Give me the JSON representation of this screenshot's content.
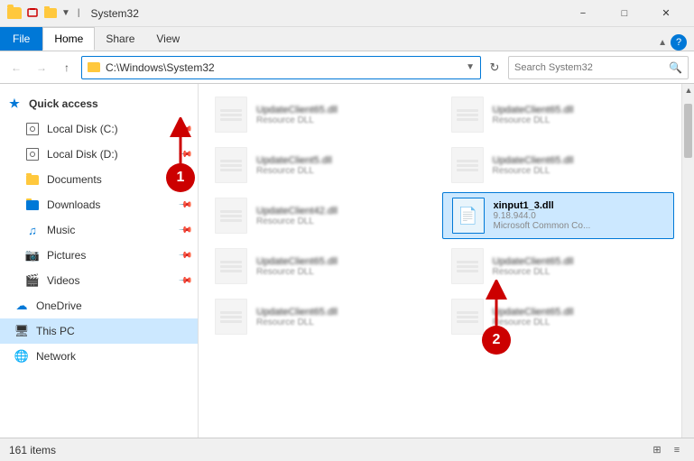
{
  "window": {
    "title": "System32",
    "title_bar_title": "System32"
  },
  "ribbon": {
    "tab_file": "File",
    "tab_home": "Home",
    "tab_share": "Share",
    "tab_view": "View",
    "active_tab": "Home"
  },
  "address_bar": {
    "path": "C:\\Windows\\System32",
    "search_placeholder": "Search System32"
  },
  "sidebar": {
    "items": [
      {
        "id": "quick-access",
        "label": "Quick access",
        "type": "section",
        "icon": "star"
      },
      {
        "id": "local-disk-c",
        "label": "Local Disk (C:)",
        "type": "disk",
        "icon": "disk",
        "pinned": true
      },
      {
        "id": "local-disk-d",
        "label": "Local Disk (D:)",
        "type": "disk",
        "icon": "disk",
        "pinned": true
      },
      {
        "id": "documents",
        "label": "Documents",
        "type": "folder",
        "icon": "folder",
        "pinned": true
      },
      {
        "id": "downloads",
        "label": "Downloads",
        "type": "folder",
        "icon": "folder",
        "pinned": true
      },
      {
        "id": "music",
        "label": "Music",
        "type": "folder",
        "icon": "music",
        "pinned": true
      },
      {
        "id": "pictures",
        "label": "Pictures",
        "type": "folder",
        "icon": "image",
        "pinned": true
      },
      {
        "id": "videos",
        "label": "Videos",
        "type": "folder",
        "icon": "video",
        "pinned": true
      },
      {
        "id": "onedrive",
        "label": "OneDrive",
        "type": "cloud",
        "icon": "cloud"
      },
      {
        "id": "this-pc",
        "label": "This PC",
        "type": "pc",
        "icon": "pc",
        "active": true
      },
      {
        "id": "network",
        "label": "Network",
        "type": "network",
        "icon": "network"
      }
    ]
  },
  "files": [
    {
      "id": 1,
      "name": "UpdateClient65.dll",
      "desc": "Resource DLL",
      "selected": false
    },
    {
      "id": 2,
      "name": "UpdateClient65.dll",
      "desc": "Resource DLL",
      "selected": false
    },
    {
      "id": 3,
      "name": "UpdateClient5.dll",
      "desc": "Resource DLL",
      "selected": false
    },
    {
      "id": 4,
      "name": "UpdateClient65.dll",
      "desc": "Resource DLL",
      "selected": false
    },
    {
      "id": 5,
      "name": "UpdateClient42.dll",
      "desc": "Resource DLL",
      "selected": false
    },
    {
      "id": 6,
      "name": "xinput1_3.dll",
      "desc": "9.18.944.0",
      "selected": true
    },
    {
      "id": 7,
      "name": "UpdateClient65.dll",
      "desc": "Resource DLL",
      "selected": false
    },
    {
      "id": 8,
      "name": "UpdateClient65.dll",
      "desc": "Resource DLL",
      "selected": false
    },
    {
      "id": 9,
      "name": "UpdateClient65.dll",
      "desc": "Resource DLL",
      "selected": false
    },
    {
      "id": 10,
      "name": "UpdateClient65.dll",
      "desc": "Resource DLL",
      "selected": false
    }
  ],
  "selected_file": {
    "name": "xinput1_3.dll",
    "version": "9.18.944.0",
    "description": "Microsoft Common Co..."
  },
  "status_bar": {
    "item_count": "161 items"
  },
  "annotations": [
    {
      "id": "1",
      "number": "1"
    },
    {
      "id": "2",
      "number": "2"
    }
  ]
}
